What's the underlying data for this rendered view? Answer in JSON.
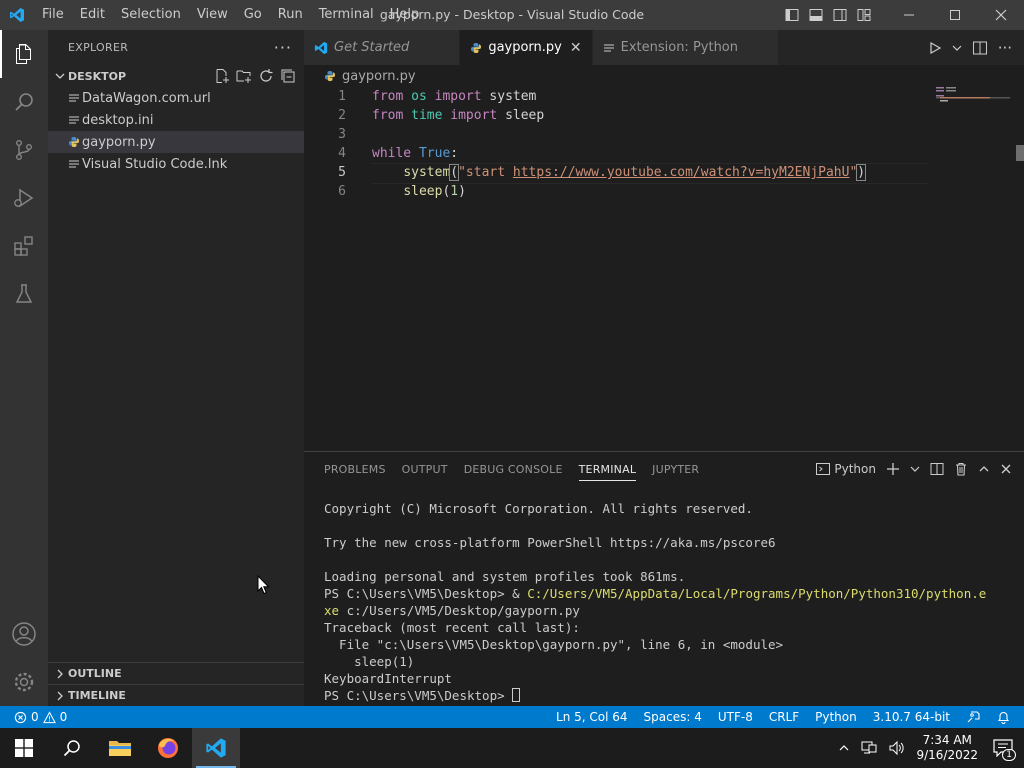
{
  "window": {
    "title": "gayporn.py - Desktop - Visual Studio Code",
    "menu": [
      "File",
      "Edit",
      "Selection",
      "View",
      "Go",
      "Run",
      "Terminal",
      "Help"
    ]
  },
  "sidebar": {
    "title": "EXPLORER",
    "folder": "DESKTOP",
    "files": [
      {
        "name": "DataWagon.com.url",
        "icon": "file-icon"
      },
      {
        "name": "desktop.ini",
        "icon": "file-icon"
      },
      {
        "name": "gayporn.py",
        "icon": "python-icon",
        "selected": true
      },
      {
        "name": "Visual Studio Code.lnk",
        "icon": "file-icon"
      }
    ],
    "outline": "OUTLINE",
    "timeline": "TIMELINE"
  },
  "tabs": [
    {
      "label": "Get Started",
      "icon": "vscode-icon",
      "active": false
    },
    {
      "label": "gayporn.py",
      "icon": "python-icon",
      "active": true
    },
    {
      "label": "Extension: Python",
      "icon": "extension-icon",
      "active": false
    }
  ],
  "breadcrumb": "gayporn.py",
  "editor": {
    "current_line": 5,
    "lines": [
      {
        "n": "1",
        "tokens": [
          [
            "kw",
            "from"
          ],
          [
            "",
            "",
            " "
          ],
          [
            "mod",
            "os"
          ],
          [
            "",
            " "
          ],
          [
            "kw",
            "import"
          ],
          [
            "",
            " "
          ],
          [
            "",
            "system"
          ]
        ]
      },
      {
        "n": "2"
      },
      {
        "n": "3"
      },
      {
        "n": "4"
      },
      {
        "n": "5"
      },
      {
        "n": "6"
      }
    ],
    "code": {
      "l1_from": "from",
      "l1_mod": "os",
      "l1_import": "import",
      "l1_name": "system",
      "l2_from": "from",
      "l2_mod": "time",
      "l2_import": "import",
      "l2_name": "sleep",
      "l4_while": "while",
      "l4_true": "True",
      "l4_colon": ":",
      "l5_fn": "system",
      "l5_open": "(",
      "l5_str_start": "\"start ",
      "l5_url": "https://www.youtube.com/watch?v=hyM2ENjPahU",
      "l5_str_end": "\"",
      "l5_close": ")",
      "l6_fn": "sleep",
      "l6_open": "(",
      "l6_num": "1",
      "l6_close": ")"
    }
  },
  "panel": {
    "tabs": [
      "PROBLEMS",
      "OUTPUT",
      "DEBUG CONSOLE",
      "TERMINAL",
      "JUPYTER"
    ],
    "active_tab": "TERMINAL",
    "terminal_type": "Python",
    "terminal_lines": {
      "l1": "Copyright (C) Microsoft Corporation. All rights reserved.",
      "l2": "",
      "l3": "Try the new cross-platform PowerShell https://aka.ms/pscore6",
      "l4": "",
      "l5": "Loading personal and system profiles took 861ms.",
      "l6_prompt": "PS C:\\Users\\VM5\\Desktop> & ",
      "l6_path": "C:/Users/VM5/AppData/Local/Programs/Python/Python310/python.e",
      "l7_path": "xe",
      "l7_rest": " c:/Users/VM5/Desktop/gayporn.py",
      "l8": "Traceback (most recent call last):",
      "l9": "  File \"c:\\Users\\VM5\\Desktop\\gayporn.py\", line 6, in <module>",
      "l10": "    sleep(1)",
      "l11": "KeyboardInterrupt",
      "l12": "PS C:\\Users\\VM5\\Desktop> "
    }
  },
  "statusbar": {
    "errors": "0",
    "warnings": "0",
    "position": "Ln 5, Col 64",
    "spaces": "Spaces: 4",
    "encoding": "UTF-8",
    "eol": "CRLF",
    "language": "Python",
    "interpreter": "3.10.7 64-bit"
  },
  "taskbar": {
    "time": "7:34 AM",
    "date": "9/16/2022",
    "notification_count": "1"
  },
  "colors": {
    "accent": "#007acc",
    "titlebar": "#3c3c3c",
    "activitybar": "#333333",
    "sidebar": "#252526",
    "editor": "#1e1e1e"
  }
}
